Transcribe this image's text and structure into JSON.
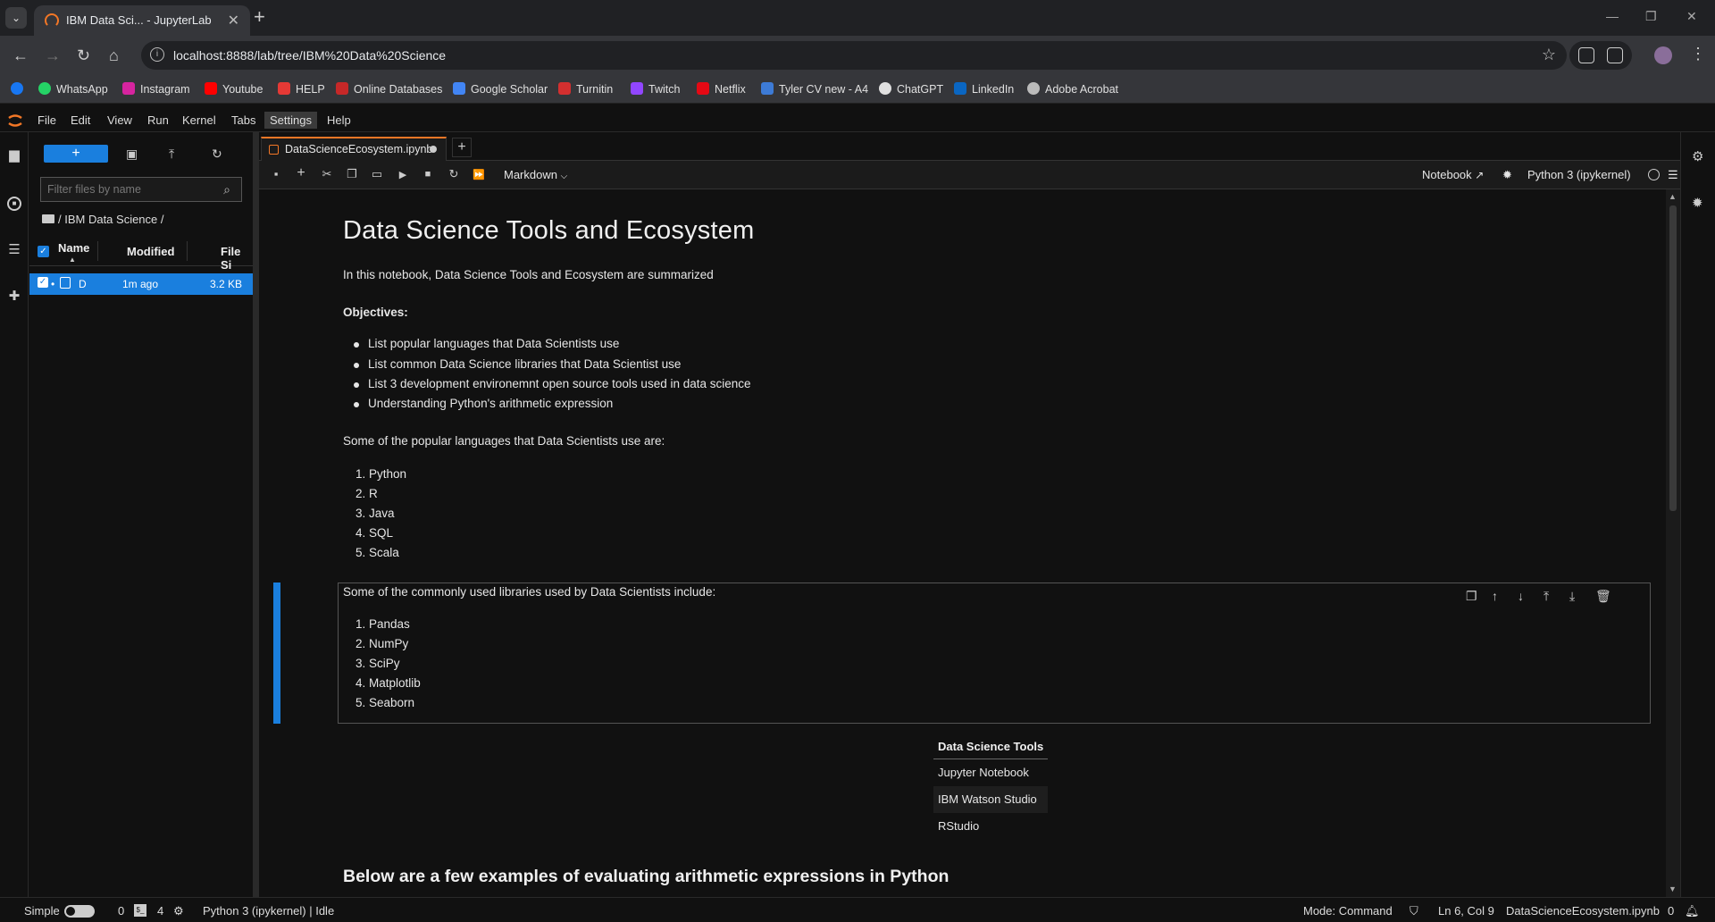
{
  "browser": {
    "tab_title": "IBM Data Sci... - JupyterLab",
    "url": "localhost:8888/lab/tree/IBM%20Data%20Science",
    "bookmarks": [
      "WhatsApp",
      "Instagram",
      "Youtube",
      "HELP",
      "Online Databases",
      "Google Scholar",
      "Turnitin",
      "Twitch",
      "Netflix",
      "Tyler CV new - A4",
      "ChatGPT",
      "LinkedIn",
      "Adobe Acrobat"
    ]
  },
  "menu": [
    "File",
    "Edit",
    "View",
    "Run",
    "Kernel",
    "Tabs",
    "Settings",
    "Help"
  ],
  "filebrowser": {
    "new_label": "+",
    "filter_placeholder": "Filter files by name",
    "breadcrumb": "/ IBM Data Science /",
    "columns": {
      "name": "Name",
      "modified": "Modified",
      "size": "File Si"
    },
    "rows": [
      {
        "name": "D",
        "modified": "1m ago",
        "size": "3.2 KB"
      }
    ]
  },
  "notebook": {
    "tab_title": "DataScienceEcosystem.ipynb",
    "cell_type": "Markdown",
    "notebook_label": "Notebook",
    "kernel_label": "Python 3 (ipykernel)"
  },
  "content": {
    "title": "Data Science Tools and Ecosystem",
    "intro": "In this notebook, Data Science Tools and Ecosystem are summarized",
    "objectives_label": "Objectives:",
    "objectives": [
      "List popular languages that Data Scientists use",
      "List common Data Science libraries that Data Scientist use",
      "List 3 development environemnt open source tools used in data science",
      "Understanding Python's arithmetic expression"
    ],
    "languages_intro": "Some of the popular languages that Data Scientists use are:",
    "languages": [
      "1. Python",
      "2. R",
      "3. Java",
      "4. SQL",
      "5. Scala"
    ],
    "libraries_intro": "Some of the commonly used libraries used by Data Scientists include:",
    "libraries": [
      "1. Pandas",
      "2. NumPy",
      "3. SciPy",
      "4. Matplotlib",
      "5. Seaborn"
    ],
    "tools_header": "Data Science Tools",
    "tools": [
      "Jupyter Notebook",
      "IBM Watson Studio",
      "RStudio"
    ],
    "arith_heading": "Below are a few examples of evaluating arithmetic expressions in Python"
  },
  "status": {
    "mode_label": "Simple",
    "terminals": "0",
    "kernels": "4",
    "kernel_status": "Python 3 (ipykernel) | Idle",
    "mode": "Mode: Command",
    "cursor": "Ln 6, Col 9",
    "file": "DataScienceEcosystem.ipynb",
    "notifications": "0"
  },
  "colors": {
    "accent": "#1a7fde",
    "jupyter_orange": "#f37726"
  }
}
